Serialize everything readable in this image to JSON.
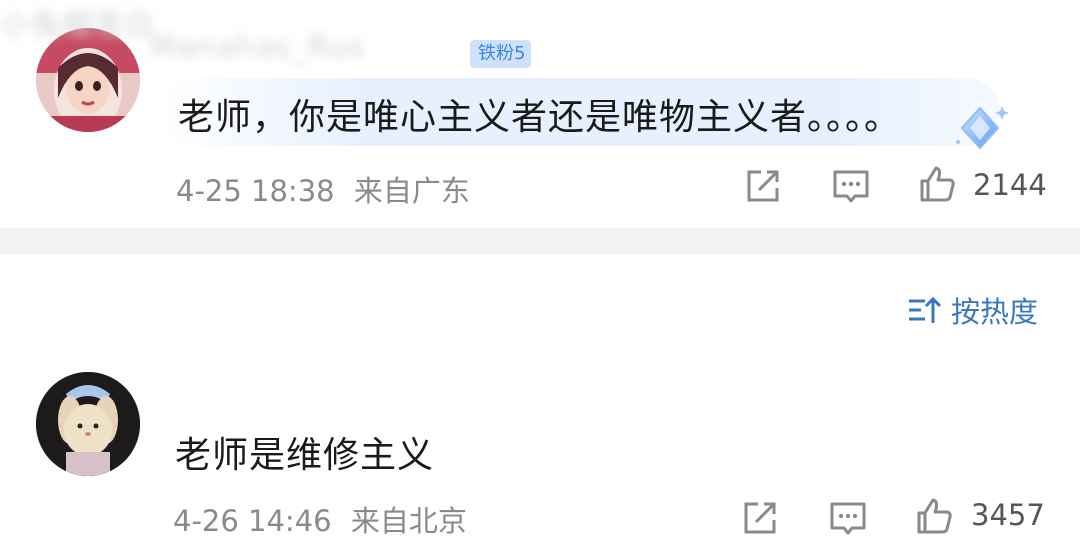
{
  "comments": [
    {
      "username": "Manahas_Rus",
      "fan_badge": "铁粉5",
      "text": "老师，你是唯心主义者还是唯物主义者。。。。",
      "date": "4-25 18:38",
      "location": "来自广东",
      "likes": "2144"
    },
    {
      "username": "小兔榴莲白",
      "text": "老师是维修主义",
      "date": "4-26 14:46",
      "location": "来自北京",
      "likes": "3457"
    }
  ],
  "sort": {
    "label": "按热度"
  },
  "colors": {
    "accent": "#3a76c4",
    "meta_text": "#8a8a8a",
    "badge_bg": "#cfe2fb",
    "highlight_bg": "#e6f0ff"
  },
  "icons": [
    "share-icon",
    "comment-icon",
    "like-icon",
    "sort-icon",
    "diamond-icon"
  ]
}
